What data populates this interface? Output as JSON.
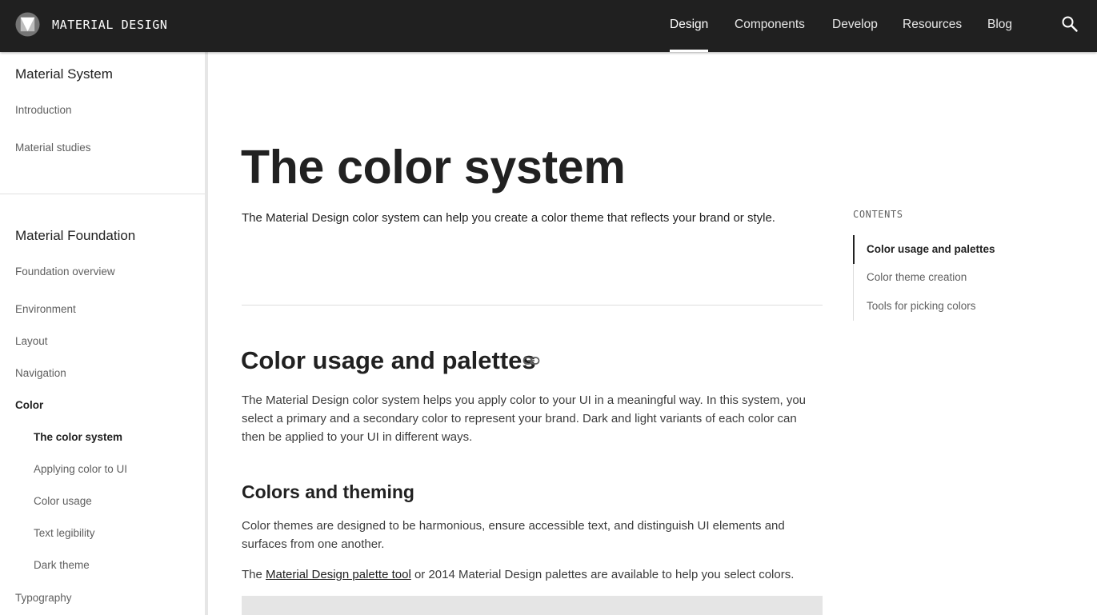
{
  "header": {
    "brand": "MATERIAL DESIGN",
    "nav": [
      {
        "label": "Design",
        "active": true
      },
      {
        "label": "Components",
        "active": false
      },
      {
        "label": "Develop",
        "active": false
      },
      {
        "label": "Resources",
        "active": false
      },
      {
        "label": "Blog",
        "active": false
      }
    ],
    "icons": {
      "logo": "material-logo-icon",
      "search": "search-icon"
    }
  },
  "sidebar": {
    "sections": [
      {
        "heading": "Material System",
        "items": [
          {
            "label": "Introduction"
          },
          {
            "label": "Material studies"
          }
        ]
      },
      {
        "heading": "Material Foundation",
        "items": [
          {
            "label": "Foundation overview"
          },
          {
            "label": "Environment"
          },
          {
            "label": "Layout"
          },
          {
            "label": "Navigation"
          },
          {
            "label": "Color",
            "expanded": true
          },
          {
            "label": "The color system",
            "child": true,
            "selected": true
          },
          {
            "label": "Applying color to UI",
            "child": true
          },
          {
            "label": "Color usage",
            "child": true
          },
          {
            "label": "Text legibility",
            "child": true
          },
          {
            "label": "Dark theme",
            "child": true
          },
          {
            "label": "Typography"
          }
        ]
      }
    ]
  },
  "main": {
    "title": "The color system",
    "lead": "The Material Design color system can help you create a color theme that reflects your brand or style.",
    "section1": {
      "heading": "Color usage and palettes",
      "icon": "link-icon",
      "paragraph": "The Material Design color system helps you apply color to your UI in a meaningful way. In this system, you select a primary and a secondary color to represent your brand. Dark and light variants of each color can then be applied to your UI in different ways."
    },
    "section2": {
      "heading": "Colors and theming",
      "paragraph": "Color themes are designed to be harmonious, ensure accessible text, and distinguish UI elements and surfaces from one another.",
      "palette_sentence": {
        "before": "The ",
        "link": "Material Design palette tool",
        "after": " or 2014 Material Design palettes are available to help you select colors."
      }
    }
  },
  "toc": {
    "label": "CONTENTS",
    "items": [
      {
        "label": "Color usage and palettes",
        "active": true
      },
      {
        "label": "Color theme creation",
        "active": false
      },
      {
        "label": "Tools for picking colors",
        "active": false
      }
    ]
  },
  "colors": {
    "app_bar": "#202020",
    "text_primary": "#212121",
    "text_secondary": "#5f5f5f",
    "divider": "#e0e0e0"
  }
}
